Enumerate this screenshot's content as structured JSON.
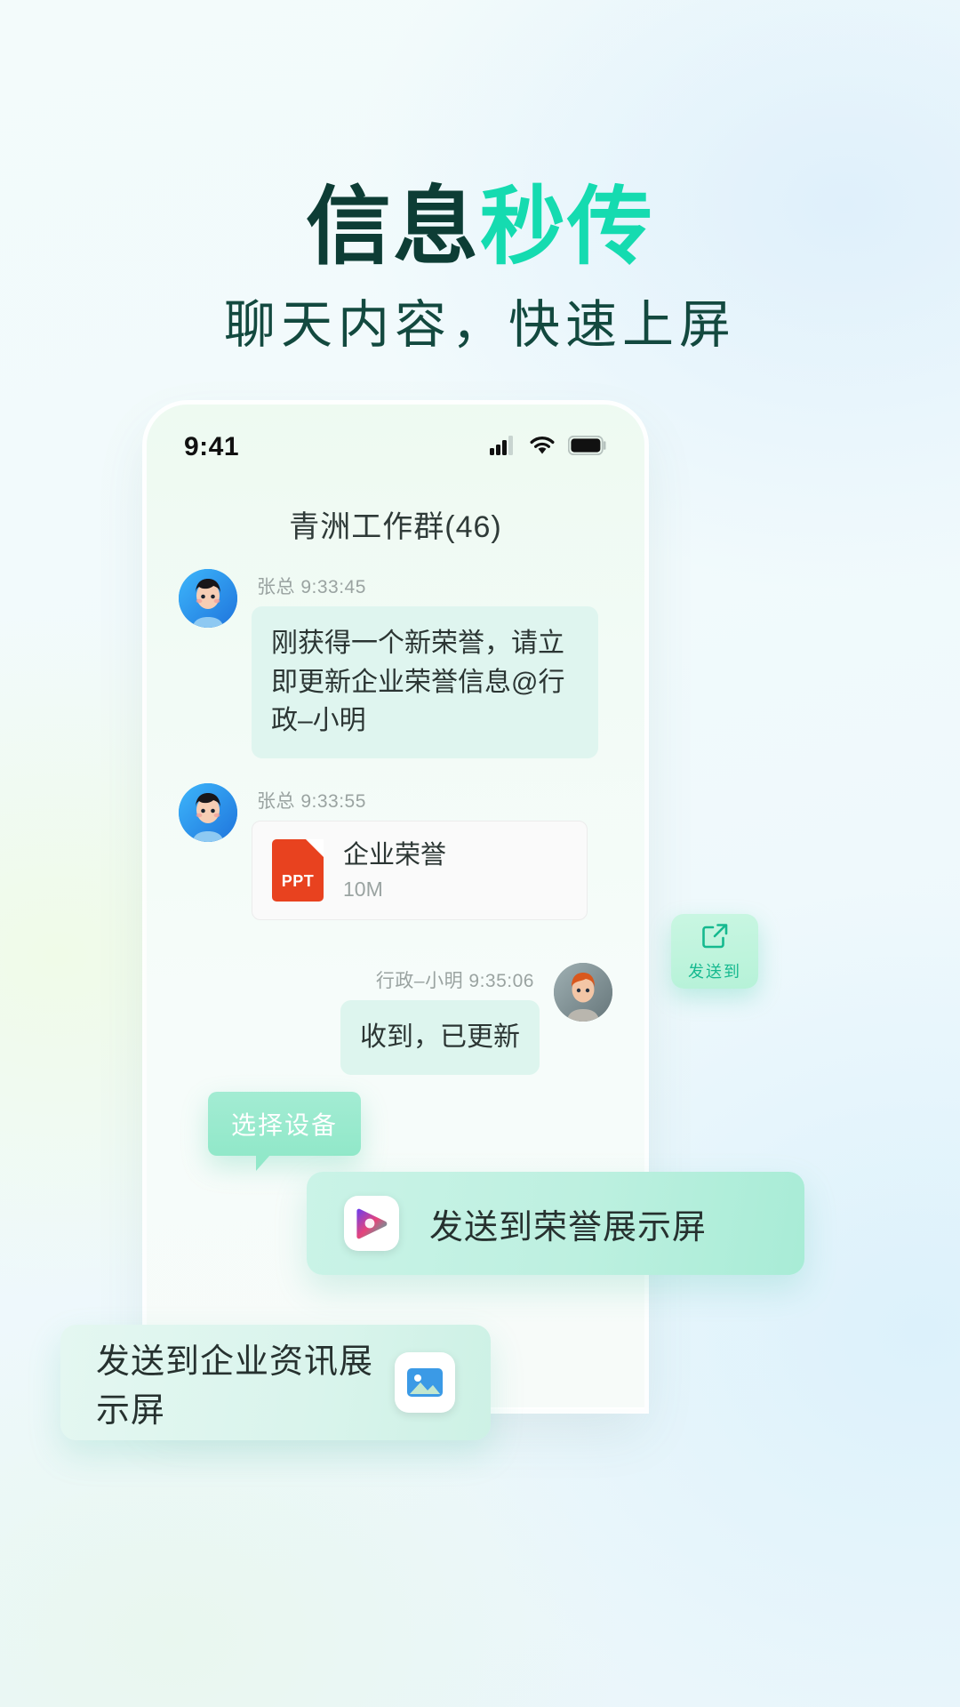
{
  "hero": {
    "title_dark": "信息",
    "title_accent": "秒传",
    "subtitle": "聊天内容，快速上屏",
    "color_dark": "#0d3d35",
    "color_accent": "#15dbb0"
  },
  "phone": {
    "statusbar": {
      "time": "9:41",
      "signal_icon": "cellular-signal-icon",
      "wifi_icon": "wifi-icon",
      "battery_icon": "battery-icon"
    },
    "chat_title": "青洲工作群(46)",
    "messages": [
      {
        "sender": "张总",
        "time": "9:33:45",
        "side": "left",
        "type": "text",
        "text": "刚获得一个新荣誉，请立即更新企业荣誉信息@行政–小明"
      },
      {
        "sender": "张总",
        "time": "9:33:55",
        "side": "left",
        "type": "file",
        "file_type": "PPT",
        "file_name": "企业荣誉",
        "file_size": "10M"
      },
      {
        "sender": "行政–小明",
        "time": "9:35:06",
        "side": "right",
        "type": "text",
        "text": "收到，已更新"
      }
    ]
  },
  "sendto_button": {
    "label": "发送到",
    "icon": "share-export-icon"
  },
  "tooltip": {
    "text": "选择设备"
  },
  "option_cards": [
    {
      "label": "发送到荣誉展示屏",
      "icon": "media-play-app-icon"
    },
    {
      "label": "发送到企业资讯展示屏",
      "icon": "photo-gallery-app-icon"
    }
  ]
}
